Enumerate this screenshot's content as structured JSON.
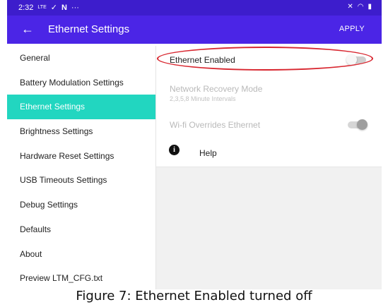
{
  "status_bar": {
    "time": "2:32",
    "network": "LTE",
    "left_icons": [
      "check-icon",
      "notification-n-icon"
    ],
    "dots": "···",
    "right_icons": [
      "mute-icon",
      "wifi-icon",
      "battery-icon"
    ]
  },
  "app_bar": {
    "title": "Ethernet Settings",
    "apply_label": "APPLY",
    "color": "#4b25e6"
  },
  "sidebar": {
    "items": [
      {
        "label": "General",
        "active": false
      },
      {
        "label": "Battery Modulation Settings",
        "active": false
      },
      {
        "label": "Ethernet Settings",
        "active": true
      },
      {
        "label": "Brightness Settings",
        "active": false
      },
      {
        "label": "Hardware Reset Settings",
        "active": false
      },
      {
        "label": "USB Timeouts Settings",
        "active": false
      },
      {
        "label": "Debug Settings",
        "active": false
      },
      {
        "label": "Defaults",
        "active": false
      },
      {
        "label": "About",
        "active": false
      },
      {
        "label": "Preview LTM_CFG.txt",
        "active": false
      }
    ],
    "active_color": "#22d6c0"
  },
  "settings": {
    "ethernet_enabled": {
      "label": "Ethernet Enabled",
      "on": false
    },
    "network_recovery": {
      "label": "Network Recovery Mode",
      "sublabel": "2,3,5,8 Minute Intervals",
      "disabled": true
    },
    "wifi_overrides": {
      "label": "Wi-fi Overrides Ethernet",
      "on": true,
      "disabled": true
    },
    "help": {
      "label": "Help",
      "icon": "info-icon"
    }
  },
  "caption": "Figure 7: Ethernet Enabled turned off",
  "annotation_color": "#d8262f"
}
